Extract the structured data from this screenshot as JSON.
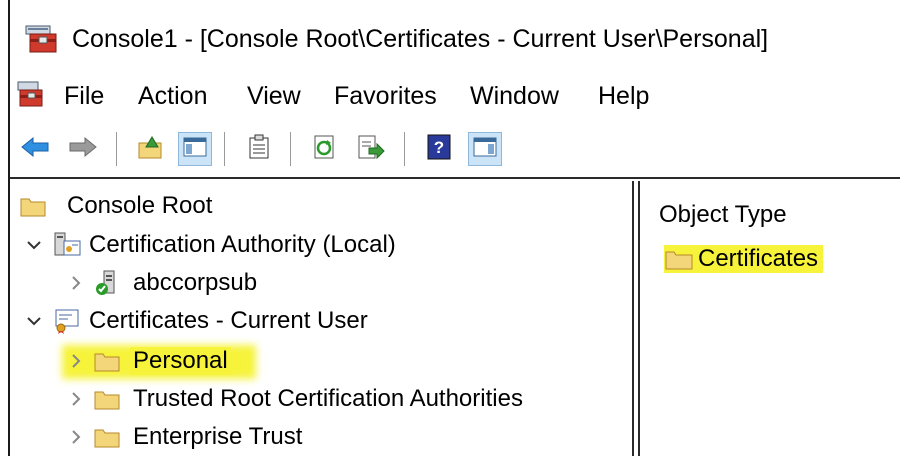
{
  "window": {
    "title": "Console1 - [Console Root\\Certificates - Current User\\Personal]"
  },
  "menu": {
    "items": [
      "File",
      "Action",
      "View",
      "Favorites",
      "Window",
      "Help"
    ]
  },
  "toolbar": {
    "buttons": [
      "back-icon",
      "forward-icon",
      "up-folder-icon",
      "show-hide-console-tree-icon",
      "properties-icon",
      "refresh-icon",
      "export-list-icon",
      "help-icon",
      "show-hide-action-pane-icon"
    ]
  },
  "tree": {
    "items": [
      {
        "label": "Console Root",
        "icon": "folder-icon"
      },
      {
        "label": "Certification Authority (Local)",
        "icon": "certification-authority-icon",
        "expanded": true
      },
      {
        "label": "abccorpsub",
        "icon": "ca-server-icon",
        "expanded": false
      },
      {
        "label": "Certificates - Current User",
        "icon": "certificates-snapin-icon",
        "expanded": true
      },
      {
        "label": "Personal",
        "icon": "folder-icon",
        "selected": true,
        "highlighted": true
      },
      {
        "label": "Trusted Root Certification Authorities",
        "icon": "folder-icon"
      },
      {
        "label": "Enterprise Trust",
        "icon": "folder-icon"
      }
    ]
  },
  "result": {
    "column_header": "Object Type",
    "items": [
      {
        "label": "Certificates",
        "icon": "folder-icon",
        "highlighted": true
      }
    ]
  },
  "colors": {
    "highlight": "#f6f33a",
    "toolbar_pressed": "#cce4f7",
    "folder": "#f3d57a"
  }
}
